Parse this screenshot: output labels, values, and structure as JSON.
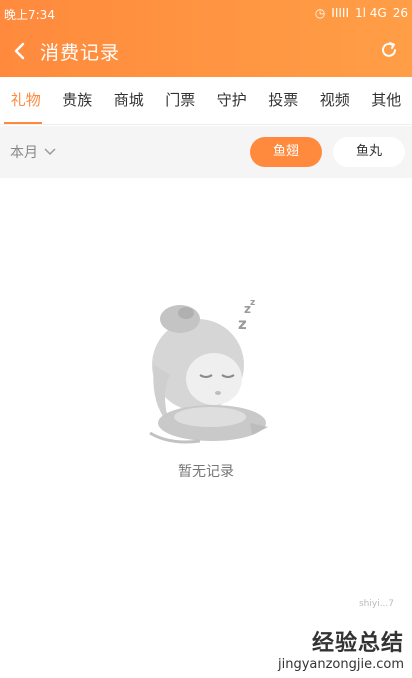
{
  "status_bar": {
    "time": "晚上7:34",
    "right": [
      "◷",
      "IIIII",
      "1l 4G",
      "26"
    ]
  },
  "header": {
    "title": "消费记录"
  },
  "tabs": [
    {
      "label": "礼物",
      "active": true
    },
    {
      "label": "贵族",
      "active": false
    },
    {
      "label": "商城",
      "active": false
    },
    {
      "label": "门票",
      "active": false
    },
    {
      "label": "守护",
      "active": false
    },
    {
      "label": "投票",
      "active": false
    },
    {
      "label": "视频",
      "active": false
    },
    {
      "label": "其他",
      "active": false
    }
  ],
  "filter": {
    "month_label": "本月",
    "currency_active": "鱼翅",
    "currency_inactive": "鱼丸"
  },
  "empty_state": {
    "text": "暂无记录"
  },
  "watermark": {
    "cn": "经验总结",
    "url": "jingyanzongjie.com",
    "small": "shiyi...7"
  },
  "colors": {
    "accent": "#ff8a3d",
    "header_gradient_end": "#ff9e46",
    "filter_bg": "#f5f5f5"
  }
}
